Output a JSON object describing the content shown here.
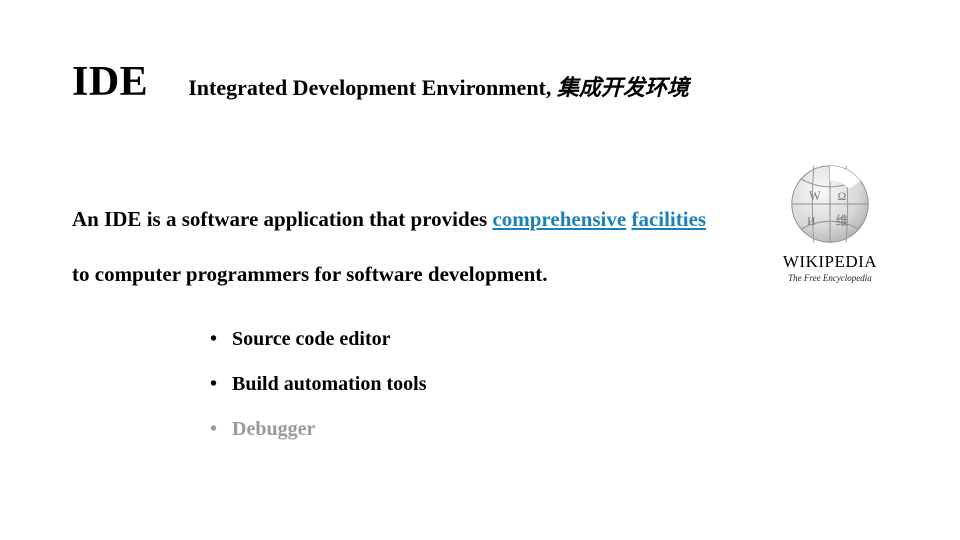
{
  "header": {
    "title": "IDE",
    "subtitle_prefix": "Integrated Development Environment, ",
    "subtitle_cn": "集成开发环境"
  },
  "description": {
    "pre": "An IDE is a software application that provides ",
    "comprehensive": "comprehensive",
    "mid": "",
    "facilities": "facilities",
    "post": " to computer programmers for software development."
  },
  "logo": {
    "wordmark": "WIKIPEDIA",
    "tagline": "The Free Encyclopedia"
  },
  "bullets": [
    {
      "label": "Source code editor",
      "muted": false
    },
    {
      "label": "Build automation tools",
      "muted": false
    },
    {
      "label": "Debugger",
      "muted": true
    }
  ]
}
